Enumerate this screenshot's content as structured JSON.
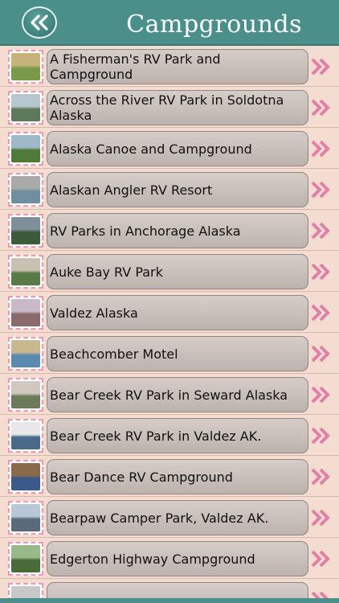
{
  "header": {
    "title": "Campgrounds",
    "back_icon": "double-chevron-left-icon"
  },
  "colors": {
    "header_bg": "#4a8f8a",
    "page_bg": "#f4dcd0",
    "row_chevron": "#e07fa8",
    "thumb_border": "#e89ab7"
  },
  "items": [
    {
      "label": "A Fisherman's RV Park and Campground",
      "thumb": [
        "#7a9a4a",
        "#c7b37a"
      ]
    },
    {
      "label": "Across the River RV Park in Soldotna Alaska",
      "thumb": [
        "#5d7a5a",
        "#b8c7cf"
      ]
    },
    {
      "label": "Alaska Canoe and Campground",
      "thumb": [
        "#4f7a3a",
        "#9fb9c9"
      ]
    },
    {
      "label": "Alaskan Angler RV Resort",
      "thumb": [
        "#6f8e9e",
        "#a9a9a9"
      ]
    },
    {
      "label": "RV Parks in Anchorage Alaska",
      "thumb": [
        "#3d5a3a",
        "#7f8f9a"
      ]
    },
    {
      "label": "Auke Bay RV Park",
      "thumb": [
        "#5a7a48",
        "#c8c0b0"
      ]
    },
    {
      "label": "Valdez Alaska",
      "thumb": [
        "#8a6a6a",
        "#c9b8c8"
      ]
    },
    {
      "label": "Beachcomber Motel",
      "thumb": [
        "#5a8ab0",
        "#c8b890"
      ]
    },
    {
      "label": "Bear Creek RV Park in Seward Alaska",
      "thumb": [
        "#6a7a5a",
        "#d0c8c0"
      ]
    },
    {
      "label": "Bear Creek RV Park in Valdez AK.",
      "thumb": [
        "#4a6a8a",
        "#e8e8e8"
      ]
    },
    {
      "label": "Bear Dance RV Campground",
      "thumb": [
        "#3a5a8a",
        "#8a6a4a"
      ]
    },
    {
      "label": "Bearpaw Camper Park, Valdez AK.",
      "thumb": [
        "#5a6a7a",
        "#b8c8d8"
      ]
    },
    {
      "label": "Edgerton Highway Campground",
      "thumb": [
        "#4a6a3a",
        "#9ab88a"
      ]
    },
    {
      "label": "",
      "thumb": [
        "#7a8a7a",
        "#c8c8c8"
      ]
    }
  ]
}
